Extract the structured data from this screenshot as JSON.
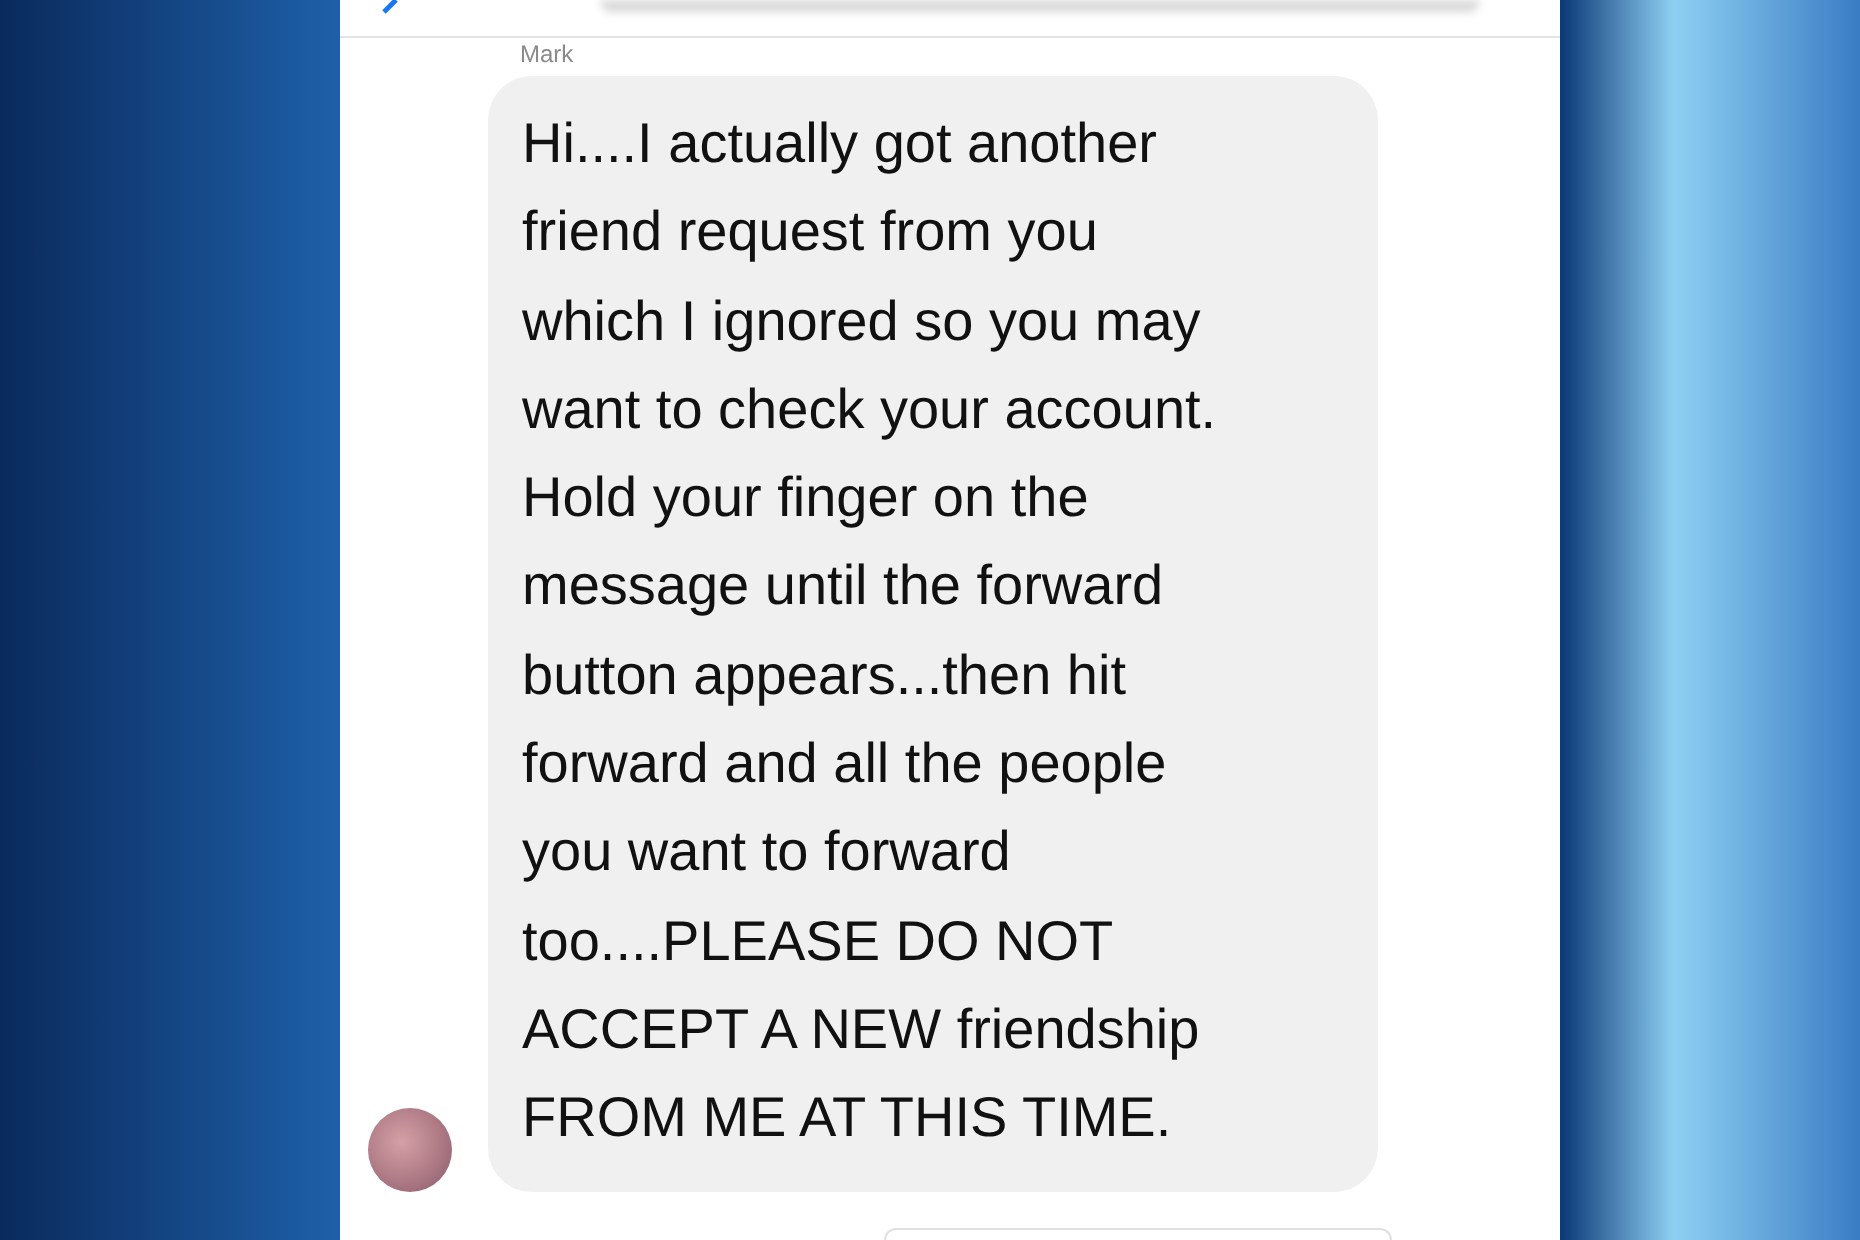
{
  "conversation": {
    "sender_name": "Mark",
    "message": {
      "lines": [
        "Hi....I actually got another",
        "friend request from you",
        "which I ignored so you may",
        "want to check your account.",
        "Hold your finger on the",
        "message until the forward",
        "button appears...then hit",
        "forward and all the people",
        "you want to forward",
        "too....PLEASE DO NOT",
        "ACCEPT A NEW friendship",
        "FROM ME AT THIS TIME."
      ]
    }
  }
}
